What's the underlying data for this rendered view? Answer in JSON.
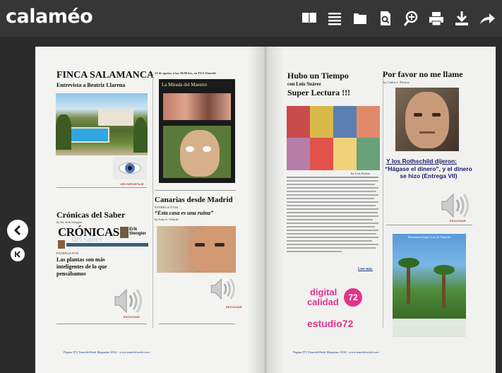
{
  "app": {
    "logo": "calaméo"
  },
  "toolbar": {
    "buttons": [
      {
        "name": "book-view",
        "icon": "open-book-icon"
      },
      {
        "name": "list-view",
        "icon": "list-icon"
      },
      {
        "name": "folder",
        "icon": "folder-icon"
      },
      {
        "name": "document",
        "icon": "document-icon"
      },
      {
        "name": "zoom",
        "icon": "zoom-in-icon"
      },
      {
        "name": "print",
        "icon": "print-icon"
      },
      {
        "name": "download",
        "icon": "download-icon"
      },
      {
        "name": "share",
        "icon": "share-icon"
      }
    ]
  },
  "left_page": {
    "finca_title": "FINCA SALAMANCA",
    "finca_subtitle": "Entrevista a Beatriz Llarena",
    "event_line": "21 de agosto, a las 20:00 hrs, en TEA Tenerife",
    "mirada_title": "La Mirada del Maestro",
    "ver_reportaje": "VER REPORTAJE",
    "cronicas_title": "Crónicas del Saber",
    "cronicas_by": "by Dr. Erik Stengler",
    "cronicas_logo": "CRÓNICAS",
    "cronicas_logo_sub": "del saber",
    "erik": "Erik Stengler",
    "entrega": "ENTREGA Nº35",
    "plantas": "Las plantas son más inteligentes de lo que pensábamos",
    "escuchar": "ESCUCHAR",
    "canarias_title": "Canarias desde Madrid",
    "canarias_entrega": "ENTREGA Nº104",
    "canarias_quote": "“Esta casa es una ruina”",
    "canarias_by": "by Juan A. Velarde",
    "footer": "Página Nº2 TenerifeWeek Magazine 2016 - www.tenerifeweek.com"
  },
  "right_page": {
    "hubo_title": "Hubo un Tiempo",
    "hubo_sub": "con Luis Suárez",
    "super": "Super Lectura !!!",
    "by_luis": "by Luis Suárez",
    "leer_mas": "Leer más.",
    "digital": "digital",
    "calidad": "calidad",
    "number": "72",
    "estudio": "estudio72",
    "favor_title": "Por favor no me llame",
    "favor_by": "by Carlos J. Álvarez",
    "rothschild": "Y los Rothschild dijeron:",
    "hagase": "“Hágase el dinero”, y el dinero se hizo (Entrega VII)",
    "escuchar": "ESCUCHAR",
    "palmetum": "Palmetum Santa Cruz de Tenerife",
    "footer": "Página Nº3 TenerifeWeek Magazine 2016 - www.tenerifeweek.com"
  },
  "colors": {
    "topbar": "#363636",
    "background": "#2b2b2b",
    "accent_pink": "#e0348b",
    "link_blue": "#1a3a8a"
  }
}
